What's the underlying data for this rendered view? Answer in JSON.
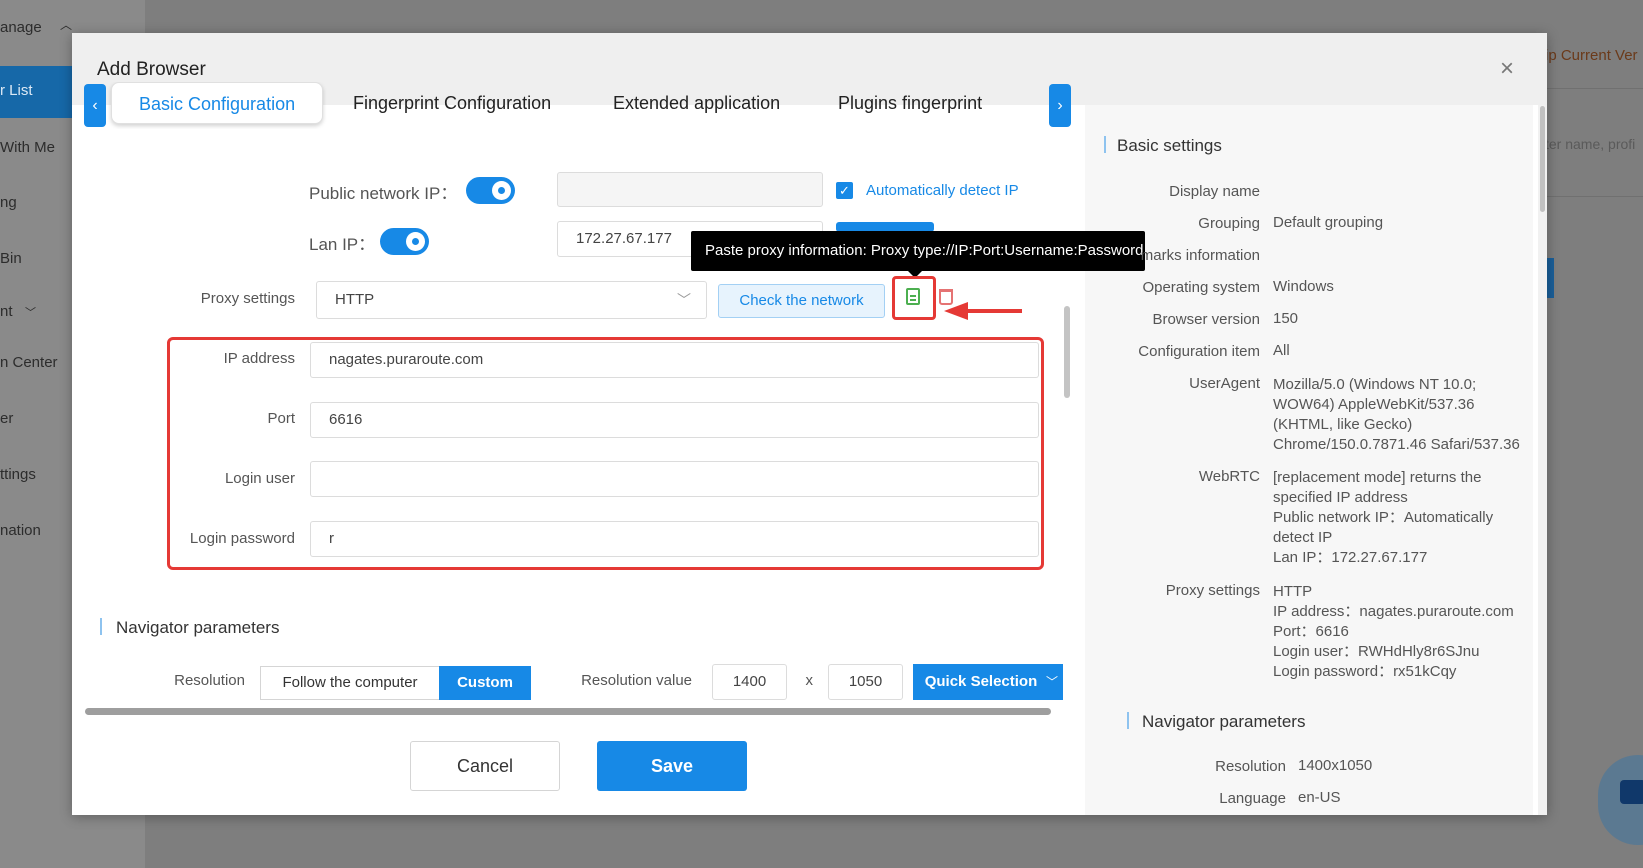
{
  "background": {
    "sidebar_items": [
      "anage",
      "r List",
      "With Me",
      "ng",
      "Bin",
      "nt",
      "n Center",
      "er",
      "ttings",
      "nation"
    ],
    "right_partial_text": "ip Current Ver",
    "search_partial_placeholder": "ter name, profi"
  },
  "modal": {
    "title": "Add Browser",
    "close_glyph": "×",
    "tabs": [
      "Basic Configuration",
      "Fingerprint Configuration",
      "Extended application",
      "Plugins fingerprint",
      "("
    ],
    "active_tab": "Basic Configuration",
    "form": {
      "public_ip_label": "Public network IP：",
      "public_ip_value": "",
      "auto_detect_label": "Automatically detect IP",
      "lan_ip_label": "Lan IP：",
      "lan_ip_value": "172.27.67.177",
      "proxy_label": "Proxy settings",
      "proxy_type": "HTTP",
      "check_network_label": "Check the network",
      "tooltip": "Paste proxy information: Proxy type://IP:Port:Username:Password",
      "ip_address_label": "IP address",
      "ip_address_value": "nagates.puraroute.com",
      "port_label": "Port",
      "port_value": "6616",
      "login_user_label": "Login user",
      "login_password_label": "Login password",
      "login_password_value": "r"
    },
    "navigator": {
      "title": "Navigator parameters",
      "resolution_label": "Resolution",
      "follow_label": "Follow the computer",
      "custom_label": "Custom",
      "resolution_value_label": "Resolution value",
      "width": "1400",
      "x_separator": "x",
      "height": "1050",
      "quick_selection_label": "Quick Selection"
    },
    "cancel_label": "Cancel",
    "save_label": "Save"
  },
  "summary": {
    "basic_title": "Basic settings",
    "rows": [
      {
        "label": "Display name",
        "value": ""
      },
      {
        "label": "Grouping",
        "value": "Default grouping"
      },
      {
        "label": "marks information",
        "value": ""
      },
      {
        "label": "Operating system",
        "value": "Windows"
      },
      {
        "label": "Browser version",
        "value": "150"
      },
      {
        "label": "Configuration item",
        "value": "All"
      }
    ],
    "useragent_label": "UserAgent",
    "useragent_lines": [
      "Mozilla/5.0 (Windows NT 10.0;",
      "WOW64) AppleWebKit/537.36",
      "(KHTML, like Gecko)",
      "Chrome/150.0.7871.46 Safari/537.36"
    ],
    "webrtc_label": "WebRTC",
    "webrtc_lines": [
      "[replacement mode] returns the",
      "specified IP address",
      "Public network IP：Automatically",
      "detect IP",
      "Lan IP：172.27.67.177"
    ],
    "proxy_label": "Proxy settings",
    "proxy_lines": [
      "HTTP",
      "IP address：nagates.puraroute.com",
      "Port：6616",
      "Login user：RWHdHly8r6SJnu",
      "Login password：rx51kCqy"
    ],
    "navigator_title": "Navigator parameters",
    "resolution_label": "Resolution",
    "resolution_value": "1400x1050",
    "language_label": "Language",
    "language_value": "en-US"
  },
  "colors": {
    "accent": "#1789e6",
    "highlight": "#e53935",
    "paste_icon": "#4caf50"
  }
}
